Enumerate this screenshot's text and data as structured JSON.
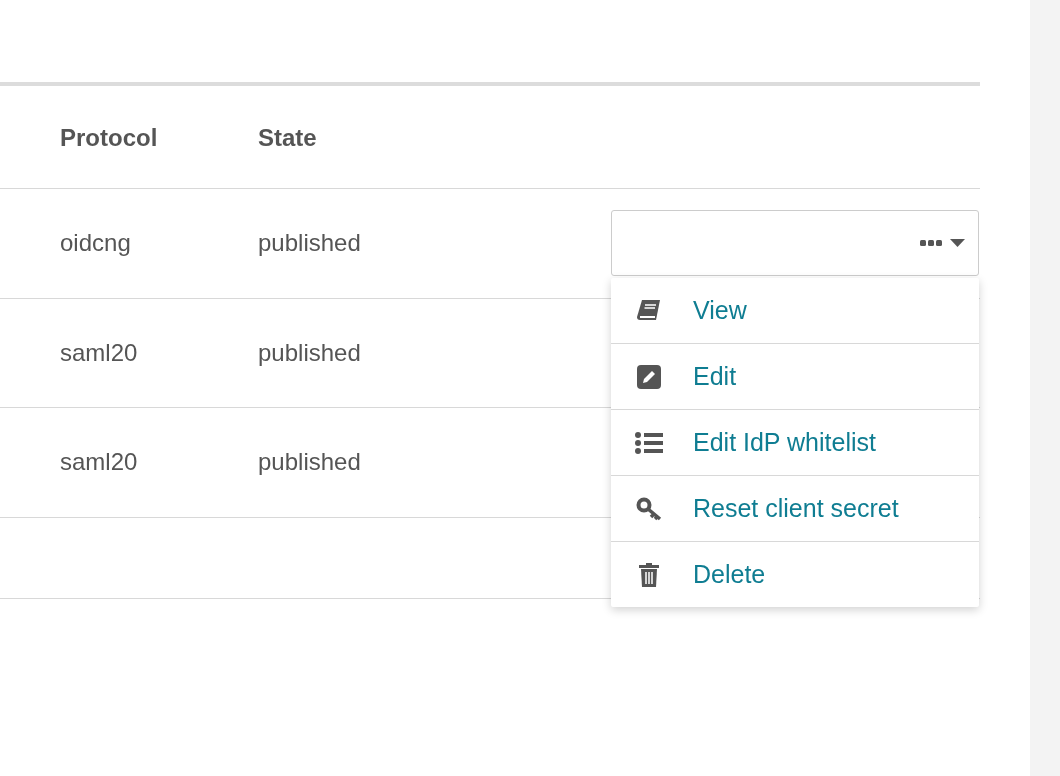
{
  "table": {
    "columns": [
      "Protocol",
      "State"
    ],
    "rows": [
      {
        "cells": [
          "oidcng",
          "published"
        ],
        "menu_open": true
      },
      {
        "cells": [
          "saml20",
          "published"
        ],
        "menu_open": false
      },
      {
        "cells": [
          "saml20",
          "published"
        ],
        "menu_open": false
      }
    ]
  },
  "actions_menu": {
    "items": [
      {
        "kind": "book",
        "label": "View"
      },
      {
        "kind": "pencil",
        "label": "Edit"
      },
      {
        "kind": "list",
        "label": "Edit IdP whitelist"
      },
      {
        "kind": "key",
        "label": "Reset client secret"
      },
      {
        "kind": "trash",
        "label": "Delete"
      }
    ]
  }
}
